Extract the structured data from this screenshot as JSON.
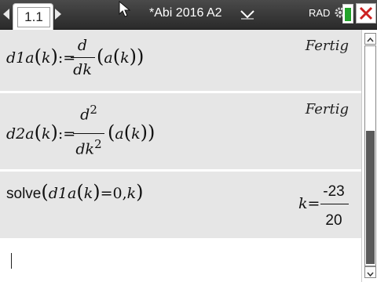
{
  "titlebar": {
    "tab_label": "1.1",
    "document_title": "*Abi 2016 A2",
    "angle_mode": "RAD",
    "icons": [
      "chevron-left-icon",
      "chevron-right-icon",
      "cursor-icon",
      "chevron-down-icon",
      "gear-icon",
      "battery-icon",
      "close-icon"
    ],
    "battery_color": "#22a32a",
    "close_color": "#cc2020"
  },
  "history": {
    "entries": [
      {
        "input": {
          "name": "d1a",
          "arg": "k",
          "assign": ":=",
          "numerator": "d",
          "denominator": "dk",
          "inner_func": "a",
          "inner_arg": "k"
        },
        "result": "Fertig"
      },
      {
        "input": {
          "name": "d2a",
          "arg": "k",
          "assign": ":=",
          "numerator": "d",
          "numerator_exp": "2",
          "denominator": "dk",
          "denominator_exp": "2",
          "inner_func": "a",
          "inner_arg": "k"
        },
        "result": "Fertig"
      },
      {
        "input": {
          "func": "solve",
          "inner_func": "d1a",
          "inner_arg": "k",
          "equation_rhs": "=0,",
          "variable": "k"
        },
        "result": {
          "variable": "k",
          "equals": "=",
          "numerator": "-23",
          "denominator": "20"
        }
      }
    ]
  },
  "colors": {
    "entry_bg": "#e6e6e6",
    "titlebar_bg": "#333333",
    "scroll_thumb": "#5a5a5a"
  }
}
